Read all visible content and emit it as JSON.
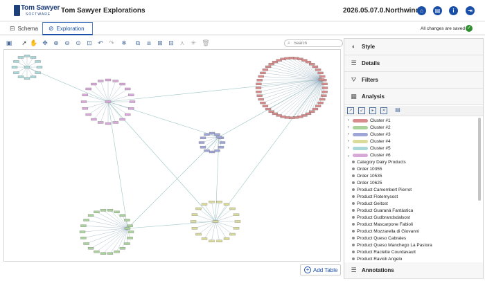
{
  "header": {
    "logo_top": "Tom Sawyer",
    "logo_bottom": "SOFTWARE",
    "app_title": "Tom Sawyer Explorations",
    "version": "2026.05.07.0.Northwind",
    "icons": [
      "home-icon",
      "document-icon",
      "info-icon",
      "logout-icon"
    ]
  },
  "tabs": [
    {
      "label": "Schema",
      "icon": "schema-icon",
      "active": false
    },
    {
      "label": "Exploration",
      "icon": "compass-icon",
      "active": true
    }
  ],
  "status": {
    "saved_text": "All changes are saved",
    "color": "#2f8f2f"
  },
  "toolbar": {
    "icons": [
      "image-icon",
      "pointer-icon",
      "hand-icon",
      "move-icon",
      "zoom-in-icon",
      "zoom-out-icon",
      "zoom-fit-icon",
      "zoom-selection-icon",
      "undo-icon",
      "redo-icon",
      "layout-icon",
      "group-icon",
      "ungroup-icon",
      "expand-icon",
      "collapse-icon",
      "table-icon",
      "filter-icon",
      "pin-icon",
      "delete-icon"
    ],
    "search_placeholder": "Search"
  },
  "canvas": {
    "add_table_label": "Add Table"
  },
  "panel": {
    "sections": [
      {
        "label": "Style",
        "icon": "palette-icon"
      },
      {
        "label": "Details",
        "icon": "list-icon"
      },
      {
        "label": "Filters",
        "icon": "funnel-icon"
      },
      {
        "label": "Analysis",
        "icon": "database-icon"
      }
    ],
    "analysis_tools": [
      "expand-all-icon",
      "collapse-all-icon",
      "export-icon",
      "clear-icon",
      "report-icon"
    ],
    "clusters": [
      {
        "label": "Cluster #1",
        "color": "#d98a8a",
        "expanded": false
      },
      {
        "label": "Cluster #2",
        "color": "#a9d39a",
        "expanded": false
      },
      {
        "label": "Cluster #3",
        "color": "#9ea6d8",
        "expanded": false
      },
      {
        "label": "Cluster #4",
        "color": "#dcdc9a",
        "expanded": false
      },
      {
        "label": "Cluster #5",
        "color": "#a8d8d8",
        "expanded": false
      },
      {
        "label": "Cluster #6",
        "color": "#d8a8d8",
        "expanded": true
      }
    ],
    "cluster6_items": [
      "Category Dairy Products",
      "Order 10355",
      "Order 10535",
      "Order 10625",
      "Product Camembert Pierrot",
      "Product Flotemysost",
      "Product Geitost",
      "Product Guaraná Fantástica",
      "Product Gudbrandsdalsost",
      "Product Mascarpone Fabioli",
      "Product Mozzarella di Giovanni",
      "Product Queso Cabrales",
      "Product Queso Manchego La Pastora",
      "Product Raclette Courdavault",
      "Product Ravioli Angelo"
    ],
    "annotations_label": "Annotations",
    "annotations_icon": "list-icon"
  }
}
